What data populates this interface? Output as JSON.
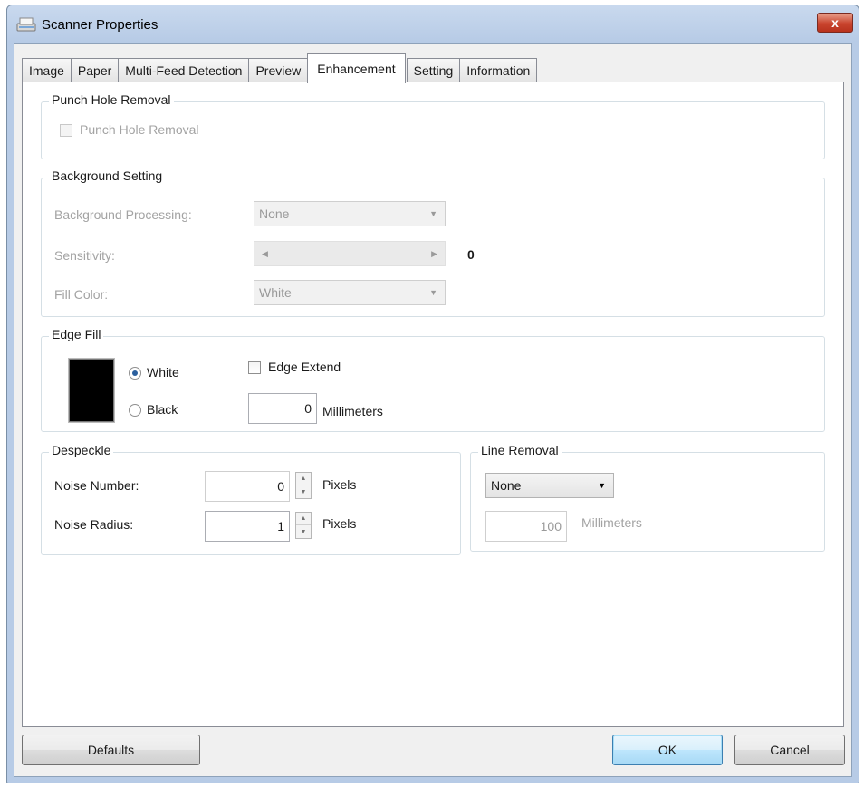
{
  "window": {
    "title": "Scanner Properties",
    "close_label": "x"
  },
  "tabs": [
    {
      "label": "Image"
    },
    {
      "label": "Paper"
    },
    {
      "label": "Multi-Feed Detection"
    },
    {
      "label": "Preview"
    },
    {
      "label": "Enhancement",
      "active": true
    },
    {
      "label": "Setting"
    },
    {
      "label": "Information"
    }
  ],
  "punch_hole": {
    "group_title": "Punch Hole Removal",
    "checkbox_label": "Punch Hole Removal",
    "checked": false,
    "enabled": false
  },
  "background": {
    "group_title": "Background Setting",
    "processing_label": "Background Processing:",
    "processing_value": "None",
    "sensitivity_label": "Sensitivity:",
    "sensitivity_value": "0",
    "fill_color_label": "Fill Color:",
    "fill_color_value": "White"
  },
  "edge_fill": {
    "group_title": "Edge Fill",
    "white_label": "White",
    "black_label": "Black",
    "selected": "White",
    "extend_label": "Edge Extend",
    "extend_checked": false,
    "value": "0",
    "unit": "Millimeters",
    "preview_color": "#000000"
  },
  "despeckle": {
    "group_title": "Despeckle",
    "noise_number_label": "Noise Number:",
    "noise_number_value": "0",
    "noise_radius_label": "Noise Radius:",
    "noise_radius_value": "1",
    "unit": "Pixels"
  },
  "line_removal": {
    "group_title": "Line Removal",
    "mode_value": "None",
    "length_value": "100",
    "unit": "Millimeters"
  },
  "buttons": {
    "defaults": "Defaults",
    "ok": "OK",
    "cancel": "Cancel"
  },
  "colors": {
    "title_bar": "#b7cbe6",
    "close": "#c9442e",
    "dialog_bg": "#f0f0f0"
  }
}
